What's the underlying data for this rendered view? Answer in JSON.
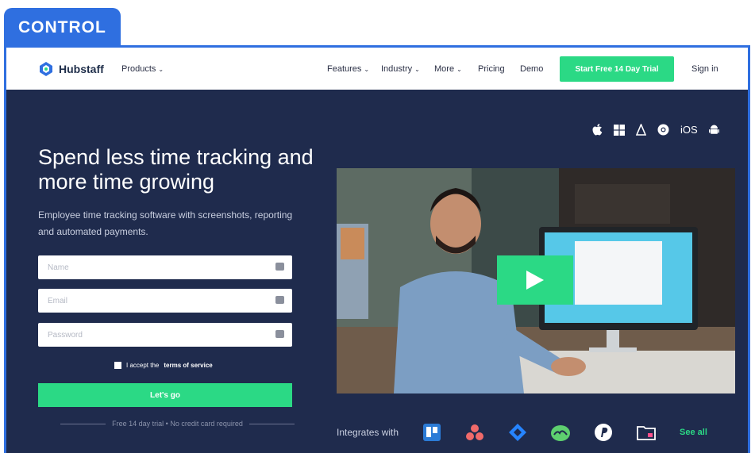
{
  "badge": {
    "label": "CONTROL"
  },
  "nav": {
    "brand": "Hubstaff",
    "products": "Products",
    "features": "Features",
    "industry": "Industry",
    "more": "More",
    "pricing": "Pricing",
    "demo": "Demo",
    "trial_button": "Start Free 14 Day Trial",
    "signin": "Sign in"
  },
  "hero": {
    "platforms": [
      "apple-icon",
      "windows-icon",
      "linux-icon",
      "chrome-icon",
      "iOS",
      "android-icon"
    ],
    "ios_label": "iOS",
    "headline": "Spend less time tracking and more time growing",
    "subline": "Employee time tracking software with screenshots, reporting and automated payments.",
    "form": {
      "name_placeholder": "Name",
      "email_placeholder": "Email",
      "password_placeholder": "Password",
      "terms_prefix": "I accept the",
      "terms_link": "terms of service",
      "submit": "Let's go",
      "fine_print": "Free 14 day trial • No credit card required"
    },
    "integrations": {
      "label": "Integrates with",
      "icons": [
        "trello-icon",
        "asana-icon",
        "jira-icon",
        "basecamp-icon",
        "paypal-icon",
        "folder-icon"
      ],
      "see_all": "See all"
    }
  },
  "colors": {
    "accent": "#2bd985",
    "hero_bg": "#1f2b4d",
    "badge": "#2f6fe0"
  }
}
